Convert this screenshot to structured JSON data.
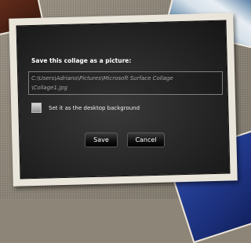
{
  "dialog": {
    "title": "Save this collage as a picture:",
    "path_line1": "C:\\Users\\Adriano\\Pictures\\Microsoft Surface Collage",
    "path_line2": "\\Collage1.jpg",
    "checkbox_label": "Set it as the desktop background",
    "checkbox_checked": false,
    "save_label": "Save",
    "cancel_label": "Cancel"
  }
}
